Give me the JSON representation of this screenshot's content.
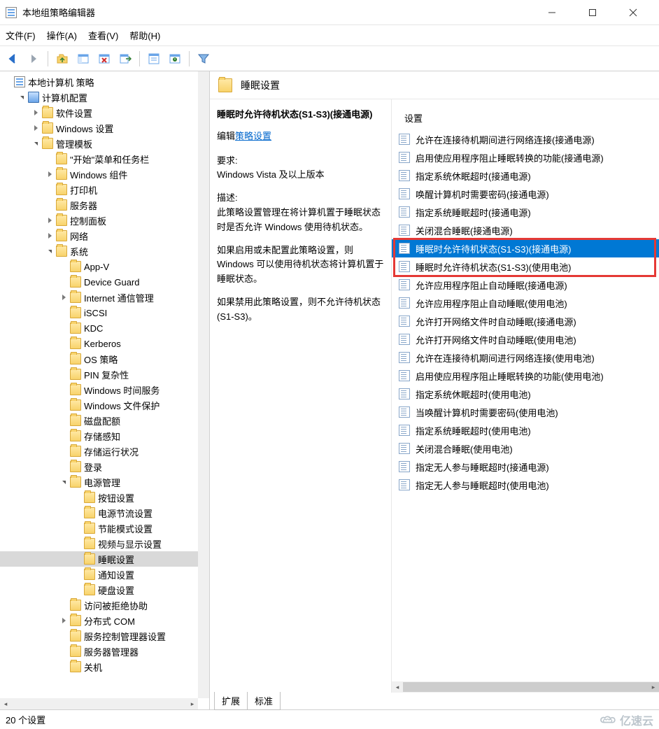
{
  "window": {
    "title": "本地组策略编辑器"
  },
  "menu": {
    "file": "文件(F)",
    "action": "操作(A)",
    "view": "查看(V)",
    "help": "帮助(H)"
  },
  "content": {
    "header_title": "睡眠设置",
    "policy_name": "睡眠时允许待机状态(S1-S3)(接通电源)",
    "edit_label": "编辑",
    "edit_link": "策略设置",
    "req_label": "要求:",
    "req_text": "Windows Vista 及以上版本",
    "desc_label": "描述:",
    "desc_p1": "此策略设置管理在将计算机置于睡眠状态时是否允许 Windows 使用待机状态。",
    "desc_p2": "如果启用或未配置此策略设置，则 Windows 可以使用待机状态将计算机置于睡眠状态。",
    "desc_p3": "如果禁用此策略设置，则不允许待机状态(S1-S3)。",
    "list_header": "设置",
    "tabs": {
      "ext": "扩展",
      "std": "标准"
    }
  },
  "status": {
    "count": "20 个设置",
    "brand": "亿速云"
  },
  "tree": [
    {
      "level": 0,
      "exp": "none",
      "icon": "root",
      "label": "本地计算机 策略"
    },
    {
      "level": 1,
      "exp": "open",
      "icon": "comp",
      "label": "计算机配置"
    },
    {
      "level": 2,
      "exp": "closed",
      "icon": "folder",
      "label": "软件设置"
    },
    {
      "level": 2,
      "exp": "closed",
      "icon": "folder",
      "label": "Windows 设置"
    },
    {
      "level": 2,
      "exp": "open",
      "icon": "folder",
      "label": "管理模板"
    },
    {
      "level": 3,
      "exp": "none",
      "icon": "folder",
      "label": "\"开始\"菜单和任务栏"
    },
    {
      "level": 3,
      "exp": "closed",
      "icon": "folder",
      "label": "Windows 组件"
    },
    {
      "level": 3,
      "exp": "none",
      "icon": "folder",
      "label": "打印机"
    },
    {
      "level": 3,
      "exp": "none",
      "icon": "folder",
      "label": "服务器"
    },
    {
      "level": 3,
      "exp": "closed",
      "icon": "folder",
      "label": "控制面板"
    },
    {
      "level": 3,
      "exp": "closed",
      "icon": "folder",
      "label": "网络"
    },
    {
      "level": 3,
      "exp": "open",
      "icon": "folder",
      "label": "系统"
    },
    {
      "level": 4,
      "exp": "none",
      "icon": "folder",
      "label": "App-V"
    },
    {
      "level": 4,
      "exp": "none",
      "icon": "folder",
      "label": "Device Guard"
    },
    {
      "level": 4,
      "exp": "closed",
      "icon": "folder",
      "label": "Internet 通信管理"
    },
    {
      "level": 4,
      "exp": "none",
      "icon": "folder",
      "label": "iSCSI"
    },
    {
      "level": 4,
      "exp": "none",
      "icon": "folder",
      "label": "KDC"
    },
    {
      "level": 4,
      "exp": "none",
      "icon": "folder",
      "label": "Kerberos"
    },
    {
      "level": 4,
      "exp": "none",
      "icon": "folder",
      "label": "OS 策略"
    },
    {
      "level": 4,
      "exp": "none",
      "icon": "folder",
      "label": "PIN 复杂性"
    },
    {
      "level": 4,
      "exp": "none",
      "icon": "folder",
      "label": "Windows 时间服务"
    },
    {
      "level": 4,
      "exp": "none",
      "icon": "folder",
      "label": "Windows 文件保护"
    },
    {
      "level": 4,
      "exp": "none",
      "icon": "folder",
      "label": "磁盘配额"
    },
    {
      "level": 4,
      "exp": "none",
      "icon": "folder",
      "label": "存储感知"
    },
    {
      "level": 4,
      "exp": "none",
      "icon": "folder",
      "label": "存储运行状况"
    },
    {
      "level": 4,
      "exp": "none",
      "icon": "folder",
      "label": "登录"
    },
    {
      "level": 4,
      "exp": "open",
      "icon": "folder",
      "label": "电源管理"
    },
    {
      "level": 5,
      "exp": "none",
      "icon": "folder",
      "label": "按钮设置"
    },
    {
      "level": 5,
      "exp": "none",
      "icon": "folder",
      "label": "电源节流设置"
    },
    {
      "level": 5,
      "exp": "none",
      "icon": "folder",
      "label": "节能模式设置"
    },
    {
      "level": 5,
      "exp": "none",
      "icon": "folder",
      "label": "视频与显示设置"
    },
    {
      "level": 5,
      "exp": "none",
      "icon": "folder",
      "label": "睡眠设置",
      "selected": true
    },
    {
      "level": 5,
      "exp": "none",
      "icon": "folder",
      "label": "通知设置"
    },
    {
      "level": 5,
      "exp": "none",
      "icon": "folder",
      "label": "硬盘设置"
    },
    {
      "level": 4,
      "exp": "none",
      "icon": "folder",
      "label": "访问被拒绝协助"
    },
    {
      "level": 4,
      "exp": "closed",
      "icon": "folder",
      "label": "分布式 COM"
    },
    {
      "level": 4,
      "exp": "none",
      "icon": "folder",
      "label": "服务控制管理器设置"
    },
    {
      "level": 4,
      "exp": "none",
      "icon": "folder",
      "label": "服务器管理器"
    },
    {
      "level": 4,
      "exp": "none",
      "icon": "folder",
      "label": "关机"
    }
  ],
  "settings": [
    {
      "label": "允许在连接待机期间进行网络连接(接通电源)"
    },
    {
      "label": "启用使应用程序阻止睡眠转换的功能(接通电源)"
    },
    {
      "label": "指定系统休眠超时(接通电源)"
    },
    {
      "label": "唤醒计算机时需要密码(接通电源)"
    },
    {
      "label": "指定系统睡眠超时(接通电源)"
    },
    {
      "label": "关闭混合睡眠(接通电源)"
    },
    {
      "label": "睡眠时允许待机状态(S1-S3)(接通电源)",
      "selected": true,
      "box": true
    },
    {
      "label": "睡眠时允许待机状态(S1-S3)(使用电池)",
      "box": true
    },
    {
      "label": "允许应用程序阻止自动睡眠(接通电源)"
    },
    {
      "label": "允许应用程序阻止自动睡眠(使用电池)"
    },
    {
      "label": "允许打开网络文件时自动睡眠(接通电源)"
    },
    {
      "label": "允许打开网络文件时自动睡眠(使用电池)"
    },
    {
      "label": "允许在连接待机期间进行网络连接(使用电池)"
    },
    {
      "label": "启用使应用程序阻止睡眠转换的功能(使用电池)"
    },
    {
      "label": "指定系统休眠超时(使用电池)"
    },
    {
      "label": "当唤醒计算机时需要密码(使用电池)"
    },
    {
      "label": "指定系统睡眠超时(使用电池)"
    },
    {
      "label": "关闭混合睡眠(使用电池)"
    },
    {
      "label": "指定无人参与睡眠超时(接通电源)"
    },
    {
      "label": "指定无人参与睡眠超时(使用电池)"
    }
  ]
}
